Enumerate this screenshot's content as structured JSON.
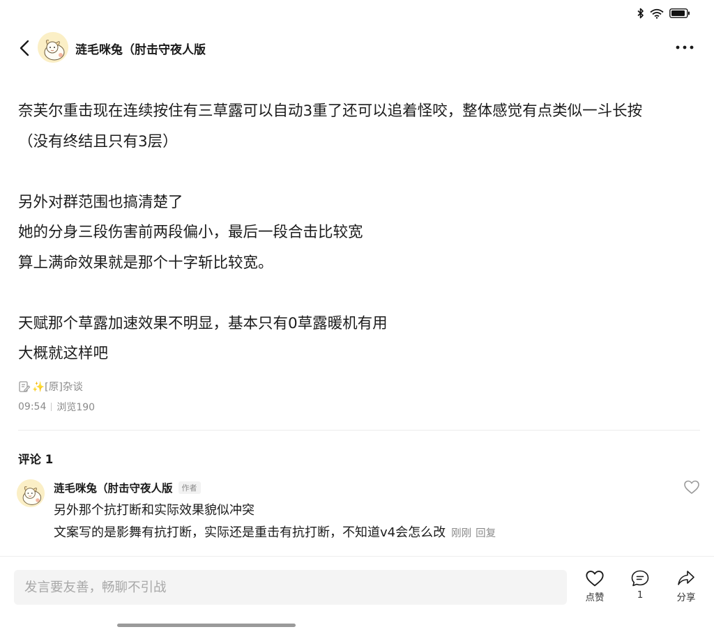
{
  "status_bar": {
    "icons": [
      "bluetooth-icon",
      "wifi-icon",
      "battery-icon"
    ]
  },
  "header": {
    "back_icon": "chevron-left-icon",
    "author": "涟毛咪兔（肘击守夜人版",
    "more_icon": "more-dots-icon"
  },
  "post": {
    "paragraphs": [
      [
        "奈芙尔重击现在连续按住有三草露可以自动3重了还可以追着怪咬，整体感觉有点类似一斗长按",
        "（没有终结且只有3层）"
      ],
      [
        "另外对群范围也搞清楚了",
        "她的分身三段伤害前两段偏小，最后一段合击比较宽",
        "算上满命效果就是那个十字斩比较宽。"
      ],
      [
        "天赋那个草露加速效果不明显，基本只有0草露暖机有用",
        "大概就这样吧"
      ]
    ],
    "tag": "✨[原]杂谈",
    "tag_icon": "edit-note-icon",
    "time": "09:54",
    "views": "浏览190"
  },
  "comments": {
    "title": "评论 1",
    "items": [
      {
        "author": "涟毛咪兔（肘击守夜人版",
        "badge": "作者",
        "line1": "另外那个抗打断和实际效果貌似冲突",
        "line2": "文案写的是影舞有抗打断，实际还是重击有抗打断，不知道v4会怎么改",
        "time": "刚刚",
        "reply": "回复"
      }
    ]
  },
  "bottom_bar": {
    "input_placeholder": "发言要友善，畅聊不引战",
    "like_label": "点赞",
    "comment_count": "1",
    "share_label": "分享"
  }
}
